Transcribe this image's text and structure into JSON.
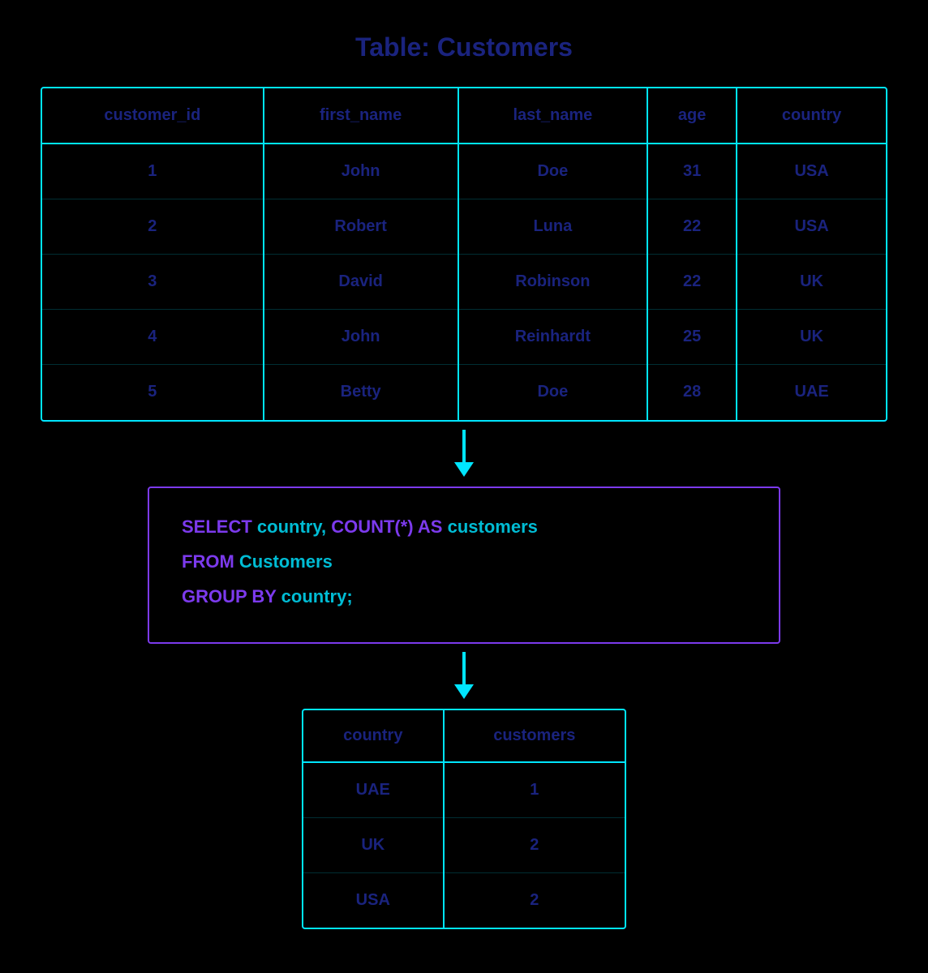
{
  "title": "Table: Customers",
  "customers_table": {
    "headers": [
      "customer_id",
      "first_name",
      "last_name",
      "age",
      "country"
    ],
    "rows": [
      [
        "1",
        "John",
        "Doe",
        "31",
        "USA"
      ],
      [
        "2",
        "Robert",
        "Luna",
        "22",
        "USA"
      ],
      [
        "3",
        "David",
        "Robinson",
        "22",
        "UK"
      ],
      [
        "4",
        "John",
        "Reinhardt",
        "25",
        "UK"
      ],
      [
        "5",
        "Betty",
        "Doe",
        "28",
        "UAE"
      ]
    ]
  },
  "sql_query": {
    "line1_keyword": "SELECT",
    "line1_text": " country, ",
    "line1_highlight": "COUNT(*) AS",
    "line1_text2": " customers",
    "line2_keyword": "FROM",
    "line2_text": " Customers",
    "line3_keyword": "GROUP BY",
    "line3_text": " country;"
  },
  "result_table": {
    "headers": [
      "country",
      "customers"
    ],
    "rows": [
      [
        "UAE",
        "1"
      ],
      [
        "UK",
        "2"
      ],
      [
        "USA",
        "2"
      ]
    ]
  },
  "colors": {
    "cyan": "#00e5ff",
    "purple": "#7c3aed",
    "dark_blue": "#1a237e"
  }
}
